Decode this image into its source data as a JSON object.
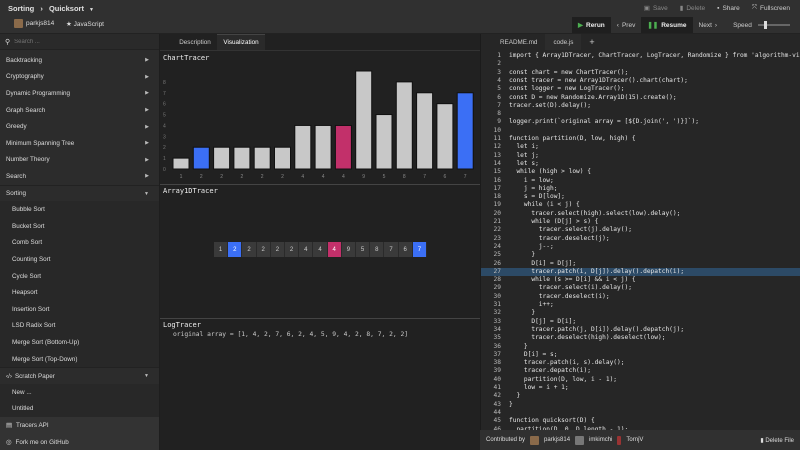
{
  "header": {
    "category": "Sorting",
    "algorithm": "Quicksort",
    "user": "parkjs814",
    "language": "JavaScript",
    "save": "Save",
    "delete": "Delete",
    "share": "Share",
    "fullscreen": "Fullscreen",
    "rerun": "Rerun",
    "prev": "Prev",
    "resume": "Resume",
    "next": "Next",
    "speed": "Speed",
    "speed_level": 0.2
  },
  "sidebar": {
    "search_placeholder": "Search ...",
    "categories": [
      "Backtracking",
      "Cryptography",
      "Dynamic Programming",
      "Graph Search",
      "Greedy",
      "Minimum Spanning Tree",
      "Number Theory",
      "Search",
      "Sorting"
    ],
    "sorting_items": [
      "Bubble Sort",
      "Bucket Sort",
      "Comb Sort",
      "Counting Sort",
      "Cycle Sort",
      "Heapsort",
      "Insertion Sort",
      "LSD Radix Sort",
      "Merge Sort (Bottom-Up)",
      "Merge Sort (Top-Down)"
    ],
    "scratch": "Scratch Paper",
    "scratch_items": [
      "New ...",
      "Untitled"
    ],
    "tracers_api": "Tracers API",
    "fork": "Fork me on GitHub"
  },
  "center": {
    "tabs": [
      "Description",
      "Visualization"
    ],
    "active_tab": "Visualization",
    "chart_title": "ChartTracer",
    "array_title": "Array1DTracer",
    "log_title": "LogTracer",
    "log_line": "original array = [1, 4, 2, 7, 6, 2, 4, 5, 9, 4, 2, 8, 7, 2, 2]"
  },
  "chart_data": {
    "type": "bar",
    "title": "ChartTracer",
    "categories": [
      "1",
      "2",
      "2",
      "2",
      "2",
      "2",
      "4",
      "4",
      "4",
      "9",
      "5",
      "8",
      "7",
      "6",
      "7"
    ],
    "values": [
      1,
      2,
      2,
      2,
      2,
      2,
      4,
      4,
      4,
      9,
      5,
      8,
      7,
      6,
      7
    ],
    "ylim": [
      0,
      9
    ],
    "yticks": [
      "0",
      "1",
      "2",
      "3",
      "4",
      "5",
      "6",
      "7",
      "8"
    ],
    "highlights": {
      "1": "#3b6ff5",
      "8": "#c2306a",
      "14": "#3b6ff5"
    },
    "bar_color": "#c8c8c8"
  },
  "editor": {
    "tabs": [
      "README.md",
      "code.js",
      "+"
    ],
    "active_tab": "code.js",
    "highlighted_line": 27,
    "lines": [
      "import { Array1DTracer, ChartTracer, LogTracer, Randomize } from 'algorithm-vi",
      "",
      "const chart = new ChartTracer();",
      "const tracer = new Array1DTracer().chart(chart);",
      "const logger = new LogTracer();",
      "const D = new Randomize.Array1D(15).create();",
      "tracer.set(D).delay();",
      "",
      "logger.print(`original array = [${D.join(', ')}]`);",
      "",
      "function partition(D, low, high) {",
      "  let i;",
      "  let j;",
      "  let s;",
      "  while (high > low) {",
      "    i = low;",
      "    j = high;",
      "    s = D[low];",
      "    while (i < j) {",
      "      tracer.select(high).select(low).delay();",
      "      while (D[j] > s) {",
      "        tracer.select(j).delay();",
      "        tracer.deselect(j);",
      "        j--;",
      "      }",
      "      D[i] = D[j];",
      "      tracer.patch(i, D[j]).delay().depatch(i);",
      "      while (s >= D[i] && i < j) {",
      "        tracer.select(i).delay();",
      "        tracer.deselect(i);",
      "        i++;",
      "      }",
      "      D[j] = D[i];",
      "      tracer.patch(j, D[i]).delay().depatch(j);",
      "      tracer.deselect(high).deselect(low);",
      "    }",
      "    D[i] = s;",
      "    tracer.patch(i, s).delay();",
      "    tracer.depatch(i);",
      "    partition(D, low, i - 1);",
      "    low = i + 1;",
      "  }",
      "}",
      "",
      "function quicksort(D) {",
      "  partition(D, 0, D.length - 1);"
    ]
  },
  "footer": {
    "contributed_by": "Contributed by",
    "contributors": [
      "parkjs814",
      "imkimchi",
      "TornjV"
    ],
    "delete_file": "Delete File"
  }
}
